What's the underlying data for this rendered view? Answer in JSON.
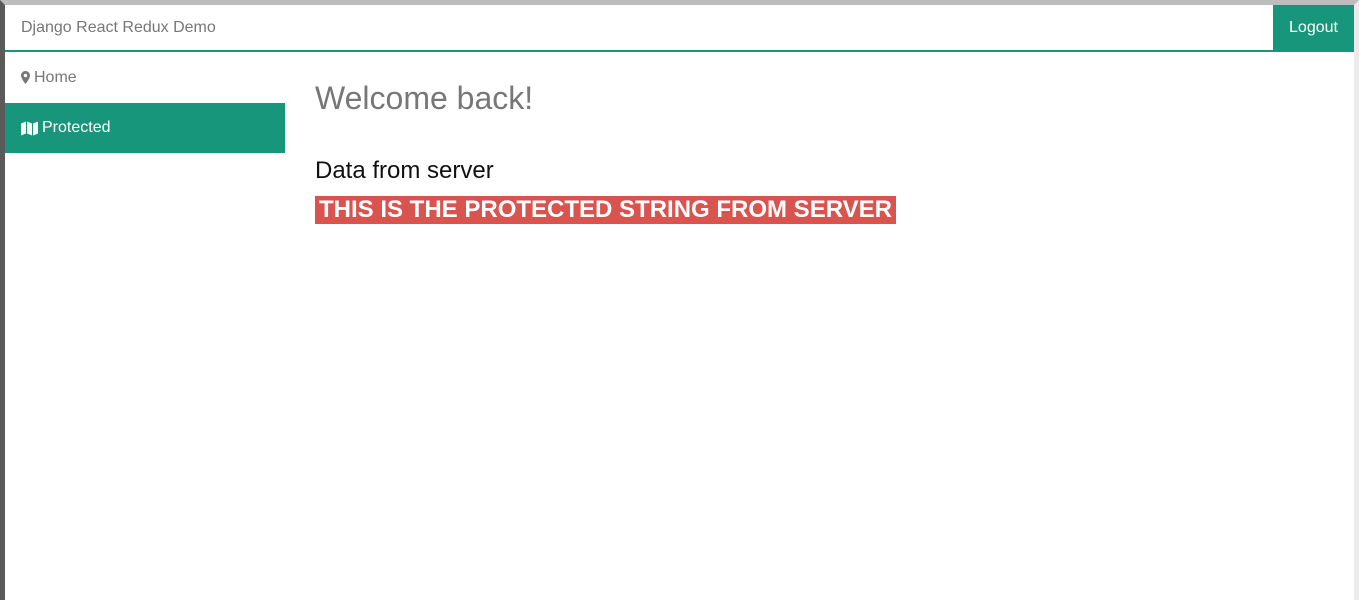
{
  "navbar": {
    "brand": "Django React Redux Demo",
    "logout_label": "Logout"
  },
  "sidebar": {
    "items": [
      {
        "label": "Home",
        "icon": "map-marker-icon",
        "active": false
      },
      {
        "label": "Protected",
        "icon": "map-icon",
        "active": true
      }
    ]
  },
  "main": {
    "welcome": "Welcome back!",
    "data_heading": "Data from server",
    "protected_string": "THIS IS THE PROTECTED STRING FROM SERVER"
  },
  "colors": {
    "accent": "#18967b",
    "danger": "#d9534f",
    "muted_text": "#777777"
  }
}
